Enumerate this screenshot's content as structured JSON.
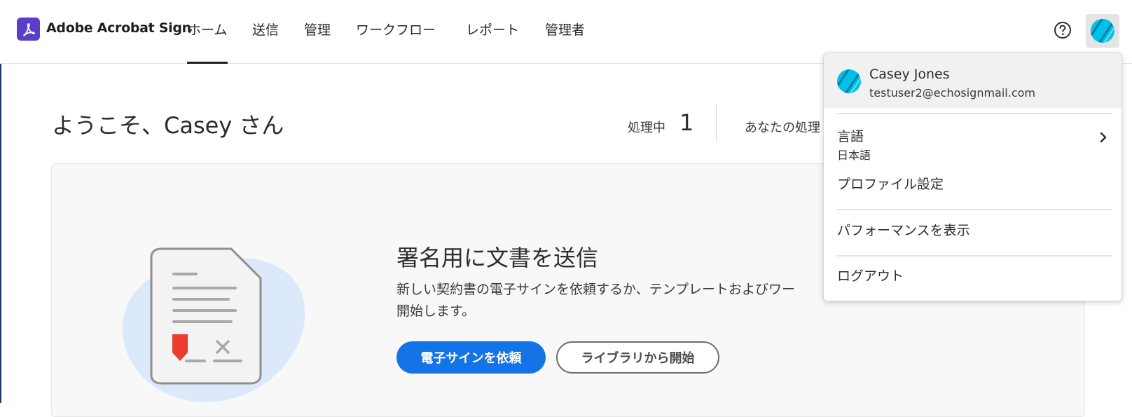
{
  "header": {
    "brand": "Adobe Acrobat Sign",
    "nav": [
      {
        "label": "ホーム",
        "active": true
      },
      {
        "label": "送信"
      },
      {
        "label": "管理"
      },
      {
        "label": "ワークフロー"
      },
      {
        "label": "レポート"
      },
      {
        "label": "管理者"
      }
    ]
  },
  "welcome": {
    "greeting": "ようこそ、Casey さん",
    "stats": {
      "in_progress_label": "処理中",
      "in_progress_count": "1",
      "your_action_label": "あなたの処理"
    }
  },
  "card": {
    "title": "署名用に文書を送信",
    "description_line1": "新しい契約書の電子サインを依頼するか、テンプレートおよびワー",
    "description_line2": "開始します。",
    "primary_button": "電子サインを依頼",
    "secondary_button": "ライブラリから開始"
  },
  "user_menu": {
    "name": "Casey Jones",
    "email": "testuser2@echosignmail.com",
    "language_label": "言語",
    "language_value": "日本語",
    "profile": "プロファイル設定",
    "performance": "パフォーマンスを表示",
    "logout": "ログアウト"
  },
  "colors": {
    "accent": "#1473e6",
    "brand_logo": "#5a3ec8",
    "avatar": "#00c2e8",
    "illustration_blob": "#dbe9fb",
    "signature_marker": "#eb3b2e"
  },
  "icons": [
    "acrobat-logo-icon",
    "help-icon",
    "avatar-icon",
    "chevron-right-icon",
    "document-illustration"
  ]
}
